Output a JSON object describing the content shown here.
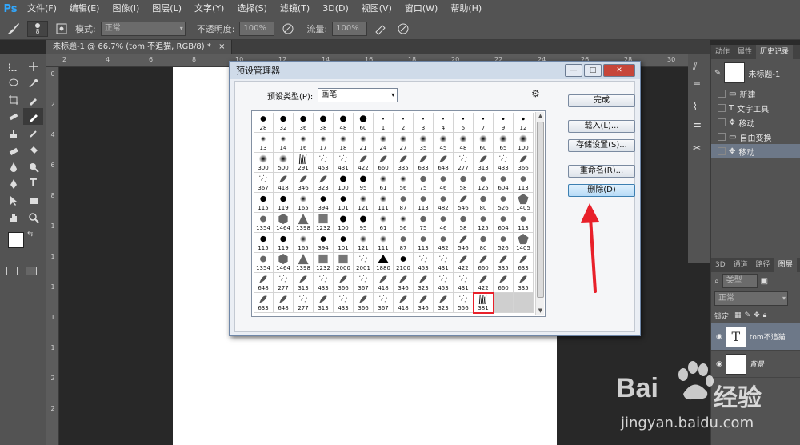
{
  "menubar": {
    "logo": "Ps",
    "items": [
      "文件(F)",
      "编辑(E)",
      "图像(I)",
      "图层(L)",
      "文字(Y)",
      "选择(S)",
      "滤镜(T)",
      "3D(D)",
      "视图(V)",
      "窗口(W)",
      "帮助(H)"
    ]
  },
  "options": {
    "brush_size": "8",
    "mode_label": "模式:",
    "mode_value": "正常",
    "opacity_label": "不透明度:",
    "opacity_value": "100%",
    "flow_label": "流量:",
    "flow_value": "100%"
  },
  "document_tab": "未标题-1 @ 66.7% (tom 不追猫, RGB/8) *",
  "rulers": {
    "h_ticks": [
      "2",
      "4",
      "6",
      "8",
      "10",
      "12",
      "14",
      "16",
      "18",
      "20",
      "22",
      "24",
      "26",
      "28",
      "30"
    ],
    "v_ticks": [
      "0",
      "2",
      "4",
      "6",
      "8",
      "1",
      "1",
      "1",
      "1",
      "1",
      "2",
      "2"
    ]
  },
  "dialog": {
    "title": "预设管理器",
    "preset_type_label": "预设类型(P):",
    "preset_type_value": "画笔",
    "buttons": {
      "done": "完成",
      "load": "载入(L)...",
      "save": "存储设置(S)...",
      "rename": "重命名(R)...",
      "delete": "删除(D)"
    },
    "brushes": [
      {
        "n": "28",
        "t": "hard",
        "s": 12
      },
      {
        "n": "32",
        "t": "hard",
        "s": 13
      },
      {
        "n": "36",
        "t": "hard",
        "s": 13
      },
      {
        "n": "38",
        "t": "hard",
        "s": 14
      },
      {
        "n": "48",
        "t": "hard",
        "s": 14
      },
      {
        "n": "60",
        "t": "hard",
        "s": 15
      },
      {
        "n": "1",
        "t": "dot",
        "s": 2
      },
      {
        "n": "2",
        "t": "dot",
        "s": 2
      },
      {
        "n": "3",
        "t": "dot",
        "s": 3
      },
      {
        "n": "4",
        "t": "dot",
        "s": 3
      },
      {
        "n": "5",
        "t": "dot",
        "s": 4
      },
      {
        "n": "7",
        "t": "dot",
        "s": 4
      },
      {
        "n": "9",
        "t": "dot",
        "s": 5
      },
      {
        "n": "12",
        "t": "dot",
        "s": 6
      },
      {
        "n": "13",
        "t": "soft",
        "s": 10
      },
      {
        "n": "14",
        "t": "soft",
        "s": 10
      },
      {
        "n": "16",
        "t": "soft",
        "s": 11
      },
      {
        "n": "17",
        "t": "soft",
        "s": 11
      },
      {
        "n": "18",
        "t": "soft",
        "s": 12
      },
      {
        "n": "21",
        "t": "soft",
        "s": 12
      },
      {
        "n": "24",
        "t": "soft",
        "s": 13
      },
      {
        "n": "27",
        "t": "soft",
        "s": 13
      },
      {
        "n": "35",
        "t": "soft",
        "s": 14
      },
      {
        "n": "45",
        "t": "soft",
        "s": 14
      },
      {
        "n": "48",
        "t": "soft",
        "s": 14
      },
      {
        "n": "60",
        "t": "soft",
        "s": 15
      },
      {
        "n": "65",
        "t": "soft",
        "s": 15
      },
      {
        "n": "100",
        "t": "soft",
        "s": 16
      },
      {
        "n": "300",
        "t": "soft",
        "s": 16
      },
      {
        "n": "500",
        "t": "soft",
        "s": 16
      },
      {
        "n": "291",
        "t": "grass",
        "s": 14
      },
      {
        "n": "453",
        "t": "scatter",
        "s": 12
      },
      {
        "n": "431",
        "t": "scatter",
        "s": 12
      },
      {
        "n": "422",
        "t": "leaf",
        "s": 13
      },
      {
        "n": "660",
        "t": "leaf",
        "s": 13
      },
      {
        "n": "335",
        "t": "leaf",
        "s": 13
      },
      {
        "n": "633",
        "t": "leaf",
        "s": 13
      },
      {
        "n": "648",
        "t": "leaf",
        "s": 13
      },
      {
        "n": "277",
        "t": "scatter",
        "s": 12
      },
      {
        "n": "313",
        "t": "leaf",
        "s": 13
      },
      {
        "n": "433",
        "t": "scatter",
        "s": 12
      },
      {
        "n": "366",
        "t": "leaf",
        "s": 13
      },
      {
        "n": "367",
        "t": "scatter",
        "s": 12
      },
      {
        "n": "418",
        "t": "leaf",
        "s": 12
      },
      {
        "n": "346",
        "t": "leaf",
        "s": 12
      },
      {
        "n": "323",
        "t": "leaf",
        "s": 12
      },
      {
        "n": "100",
        "t": "hard",
        "s": 14
      },
      {
        "n": "95",
        "t": "hard",
        "s": 14
      },
      {
        "n": "61",
        "t": "soft",
        "s": 13
      },
      {
        "n": "56",
        "t": "soft",
        "s": 12
      },
      {
        "n": "75",
        "t": "gray",
        "s": 13
      },
      {
        "n": "46",
        "t": "gray",
        "s": 12
      },
      {
        "n": "58",
        "t": "gray",
        "s": 13
      },
      {
        "n": "125",
        "t": "gray",
        "s": 12
      },
      {
        "n": "604",
        "t": "gray",
        "s": 12
      },
      {
        "n": "113",
        "t": "gray",
        "s": 12
      },
      {
        "n": "115",
        "t": "hard",
        "s": 13
      },
      {
        "n": "119",
        "t": "hard",
        "s": 13
      },
      {
        "n": "165",
        "t": "soft",
        "s": 13
      },
      {
        "n": "394",
        "t": "hard",
        "s": 12
      },
      {
        "n": "101",
        "t": "hard",
        "s": 12
      },
      {
        "n": "121",
        "t": "soft",
        "s": 13
      },
      {
        "n": "111",
        "t": "soft",
        "s": 13
      },
      {
        "n": "87",
        "t": "gray",
        "s": 12
      },
      {
        "n": "113",
        "t": "gray",
        "s": 12
      },
      {
        "n": "482",
        "t": "gray",
        "s": 12
      },
      {
        "n": "546",
        "t": "leaf",
        "s": 12
      },
      {
        "n": "80",
        "t": "gray",
        "s": 13
      },
      {
        "n": "526",
        "t": "gray",
        "s": 12
      },
      {
        "n": "1405",
        "t": "penta",
        "s": 14
      },
      {
        "n": "1354",
        "t": "gray",
        "s": 14
      },
      {
        "n": "1464",
        "t": "hexa",
        "s": 14
      },
      {
        "n": "1398",
        "t": "tri",
        "s": 14
      },
      {
        "n": "1232",
        "t": "square",
        "s": 13
      },
      {
        "n": "100",
        "t": "hard",
        "s": 14
      },
      {
        "n": "95",
        "t": "hard",
        "s": 14
      },
      {
        "n": "61",
        "t": "soft",
        "s": 13
      },
      {
        "n": "56",
        "t": "soft",
        "s": 12
      },
      {
        "n": "75",
        "t": "gray",
        "s": 13
      },
      {
        "n": "46",
        "t": "gray",
        "s": 12
      },
      {
        "n": "58",
        "t": "gray",
        "s": 13
      },
      {
        "n": "125",
        "t": "gray",
        "s": 12
      },
      {
        "n": "604",
        "t": "gray",
        "s": 12
      },
      {
        "n": "113",
        "t": "gray",
        "s": 12
      },
      {
        "n": "115",
        "t": "hard",
        "s": 13
      },
      {
        "n": "119",
        "t": "hard",
        "s": 13
      },
      {
        "n": "165",
        "t": "soft",
        "s": 13
      },
      {
        "n": "394",
        "t": "hard",
        "s": 12
      },
      {
        "n": "101",
        "t": "hard",
        "s": 12
      },
      {
        "n": "121",
        "t": "soft",
        "s": 13
      },
      {
        "n": "111",
        "t": "soft",
        "s": 13
      },
      {
        "n": "87",
        "t": "gray",
        "s": 12
      },
      {
        "n": "113",
        "t": "gray",
        "s": 12
      },
      {
        "n": "482",
        "t": "gray",
        "s": 12
      },
      {
        "n": "546",
        "t": "leaf",
        "s": 12
      },
      {
        "n": "80",
        "t": "gray",
        "s": 13
      },
      {
        "n": "526",
        "t": "gray",
        "s": 12
      },
      {
        "n": "1405",
        "t": "penta",
        "s": 14
      },
      {
        "n": "1354",
        "t": "gray",
        "s": 14
      },
      {
        "n": "1464",
        "t": "hexa",
        "s": 14
      },
      {
        "n": "1398",
        "t": "tri",
        "s": 14
      },
      {
        "n": "1232",
        "t": "square",
        "s": 13
      },
      {
        "n": "2000",
        "t": "square",
        "s": 13
      },
      {
        "n": "2001",
        "t": "scatter",
        "s": 12
      },
      {
        "n": "1880",
        "t": "blob",
        "s": 13
      },
      {
        "n": "2100",
        "t": "hard",
        "s": 12
      },
      {
        "n": "453",
        "t": "scatter",
        "s": 12
      },
      {
        "n": "431",
        "t": "scatter",
        "s": 12
      },
      {
        "n": "422",
        "t": "leaf",
        "s": 12
      },
      {
        "n": "660",
        "t": "leaf",
        "s": 12
      },
      {
        "n": "335",
        "t": "leaf",
        "s": 12
      },
      {
        "n": "633",
        "t": "leaf",
        "s": 12
      },
      {
        "n": "648",
        "t": "leaf",
        "s": 12
      },
      {
        "n": "277",
        "t": "scatter",
        "s": 12
      },
      {
        "n": "313",
        "t": "leaf",
        "s": 12
      },
      {
        "n": "433",
        "t": "scatter",
        "s": 12
      },
      {
        "n": "366",
        "t": "leaf",
        "s": 12
      },
      {
        "n": "367",
        "t": "scatter",
        "s": 12
      },
      {
        "n": "418",
        "t": "leaf",
        "s": 12
      },
      {
        "n": "346",
        "t": "leaf",
        "s": 12
      },
      {
        "n": "323",
        "t": "leaf",
        "s": 12
      },
      {
        "n": "453",
        "t": "scatter",
        "s": 12
      },
      {
        "n": "431",
        "t": "scatter",
        "s": 12
      },
      {
        "n": "422",
        "t": "leaf",
        "s": 12
      },
      {
        "n": "660",
        "t": "leaf",
        "s": 12
      },
      {
        "n": "335",
        "t": "leaf",
        "s": 12
      },
      {
        "n": "633",
        "t": "leaf",
        "s": 12
      },
      {
        "n": "648",
        "t": "leaf",
        "s": 12
      },
      {
        "n": "277",
        "t": "scatter",
        "s": 12
      },
      {
        "n": "313",
        "t": "leaf",
        "s": 12
      },
      {
        "n": "433",
        "t": "scatter",
        "s": 12
      },
      {
        "n": "366",
        "t": "leaf",
        "s": 12
      },
      {
        "n": "367",
        "t": "scatter",
        "s": 12
      },
      {
        "n": "418",
        "t": "leaf",
        "s": 12
      },
      {
        "n": "346",
        "t": "leaf",
        "s": 12
      },
      {
        "n": "323",
        "t": "leaf",
        "s": 12
      },
      {
        "n": "556",
        "t": "scatter",
        "s": 12
      },
      {
        "n": "381",
        "t": "grass",
        "s": 13,
        "hl": true
      }
    ]
  },
  "history_panel": {
    "tabs": [
      "动作",
      "属性",
      "历史记录"
    ],
    "snapshot": "未标题-1",
    "items": [
      "新建",
      "文字工具",
      "移动",
      "自由变换",
      "移动"
    ]
  },
  "layers_panel": {
    "tabs": [
      "3D",
      "通道",
      "路径",
      "图层"
    ],
    "filter_label": "类型",
    "blend_mode": "正常",
    "lock_label": "锁定:",
    "layers": [
      "tom不追猫",
      "背景"
    ]
  },
  "watermark": {
    "brand": "Bai",
    "brand_cn": "经验",
    "url": "jingyan.baidu.com"
  },
  "colors": {
    "accent_red": "#e8202a",
    "ps_blue": "#31a8ff"
  }
}
